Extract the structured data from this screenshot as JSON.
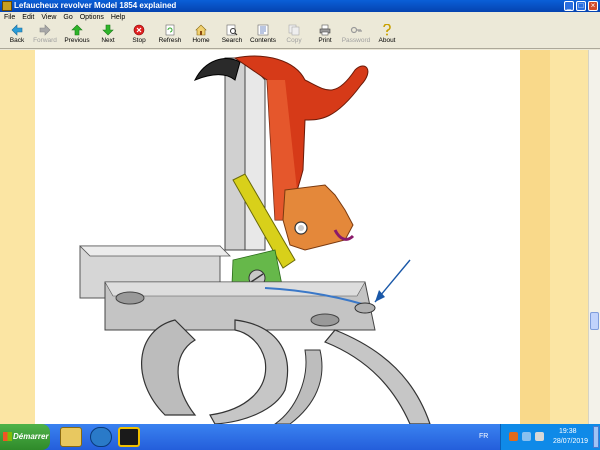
{
  "window": {
    "title": "Lefaucheux revolver Model 1854 explained",
    "minimize": "_",
    "maximize": "□",
    "close": "×"
  },
  "menu": {
    "items": [
      "File",
      "Edit",
      "View",
      "Go",
      "Options",
      "Help"
    ]
  },
  "toolbar": {
    "buttons": [
      {
        "label": "Back",
        "icon": "arrow-left-icon",
        "enabled": true
      },
      {
        "label": "Forward",
        "icon": "arrow-right-icon",
        "enabled": false
      },
      {
        "label": "Previous",
        "icon": "arrow-up-icon",
        "enabled": true
      },
      {
        "label": "Next",
        "icon": "arrow-down-icon",
        "enabled": true
      },
      {
        "label": "Stop",
        "icon": "stop-icon",
        "enabled": true
      },
      {
        "label": "Refresh",
        "icon": "refresh-icon",
        "enabled": true
      },
      {
        "label": "Home",
        "icon": "home-icon",
        "enabled": true
      },
      {
        "label": "Search",
        "icon": "search-icon",
        "enabled": true
      },
      {
        "label": "Contents",
        "icon": "contents-icon",
        "enabled": true
      },
      {
        "label": "Copy",
        "icon": "copy-icon",
        "enabled": false
      },
      {
        "label": "Print",
        "icon": "print-icon",
        "enabled": true
      },
      {
        "label": "Password",
        "icon": "key-icon",
        "enabled": false
      },
      {
        "label": "About",
        "icon": "about-icon",
        "enabled": true
      }
    ]
  },
  "colors": {
    "titlebar": "#0a5fd8",
    "page_margin": "#fbe5a3",
    "hammer_red": "#d63a18",
    "trigger_gray": "#bcbcbc",
    "spring_blue": "#3a78c8"
  },
  "taskbar": {
    "start_label": "Démarrer",
    "language": "FR",
    "time": "19:38",
    "date": "28/07/2019"
  }
}
